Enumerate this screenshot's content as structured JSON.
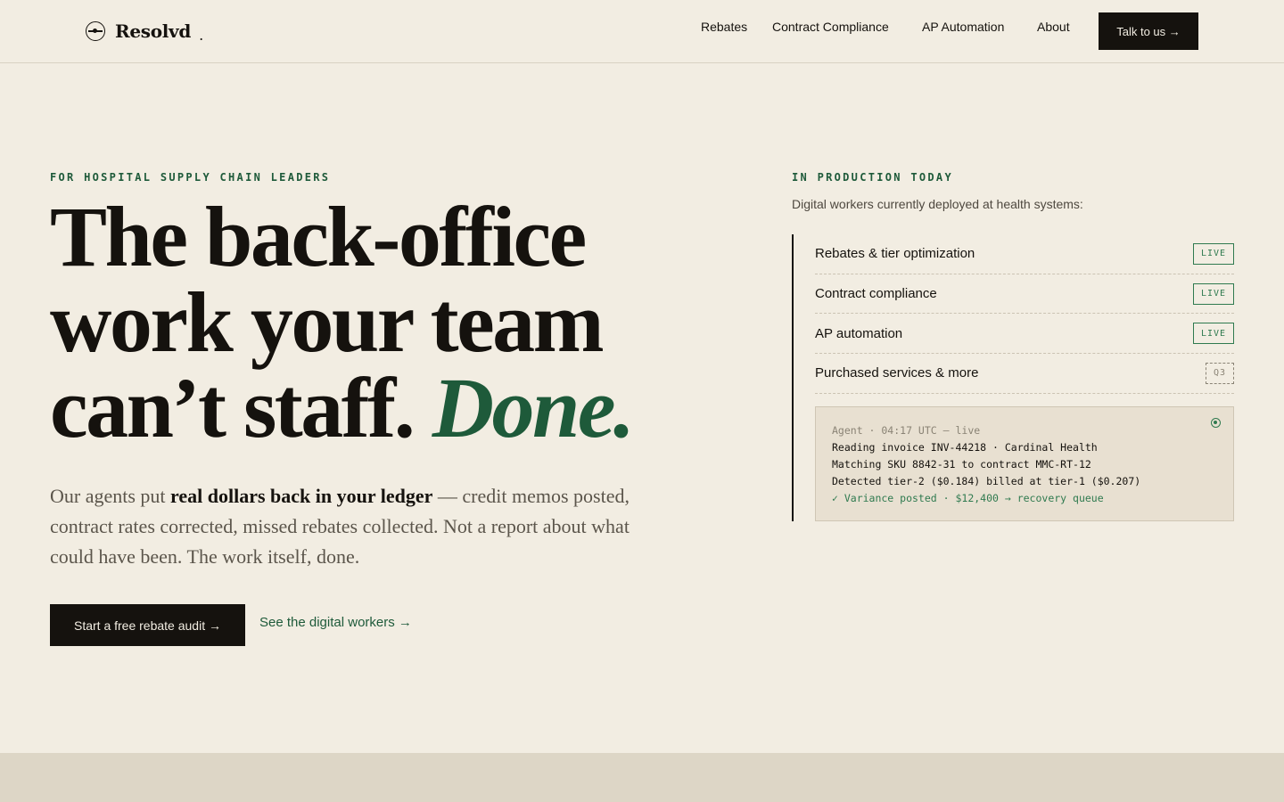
{
  "header": {
    "brand": "Resolvd",
    "brand_suffix": ".",
    "nav": [
      "Rebates",
      "Contract Compliance",
      "AP Automation",
      "About"
    ],
    "cta": "Talk to us →"
  },
  "hero": {
    "eyebrow": "FOR HOSPITAL SUPPLY CHAIN LEADERS",
    "headline_line1": "The back-office",
    "headline_line2": "work your team",
    "headline_line3_plain": "can’t staff. ",
    "headline_line3_accent": "Done.",
    "sub_before": "Our agents put ",
    "sub_strong": "real dollars back in your ledger",
    "sub_after": " — credit memos posted, contract rates corrected, missed rebates collected. Not a report about what could have been. The work itself, done.",
    "primary_cta": "Start a free rebate audit →",
    "secondary_cta": "See the digital workers →"
  },
  "production": {
    "eyebrow": "IN PRODUCTION TODAY",
    "subtitle": "Digital workers currently deployed at health systems:",
    "workers": [
      {
        "label": "Rebates & tier optimization",
        "status": "LIVE"
      },
      {
        "label": "Contract compliance",
        "status": "LIVE"
      },
      {
        "label": "AP automation",
        "status": "LIVE"
      },
      {
        "label": "Purchased services & more",
        "status": "Q3"
      }
    ],
    "console": {
      "line1": "Agent · 04:17 UTC — live",
      "line2": "Reading invoice INV-44218 · Cardinal Health",
      "line3": "Matching SKU 8842-31 to contract MMC-RT-12",
      "line4": "Detected tier-2 ($0.184) billed at tier-1 ($0.207)",
      "line5": "✓ Variance posted · $12,400 → recovery queue"
    }
  },
  "colors": {
    "background": "#f2ede2",
    "ink": "#15120e",
    "accent_green": "#1e5a3a",
    "live_green": "#2f7a4f"
  }
}
